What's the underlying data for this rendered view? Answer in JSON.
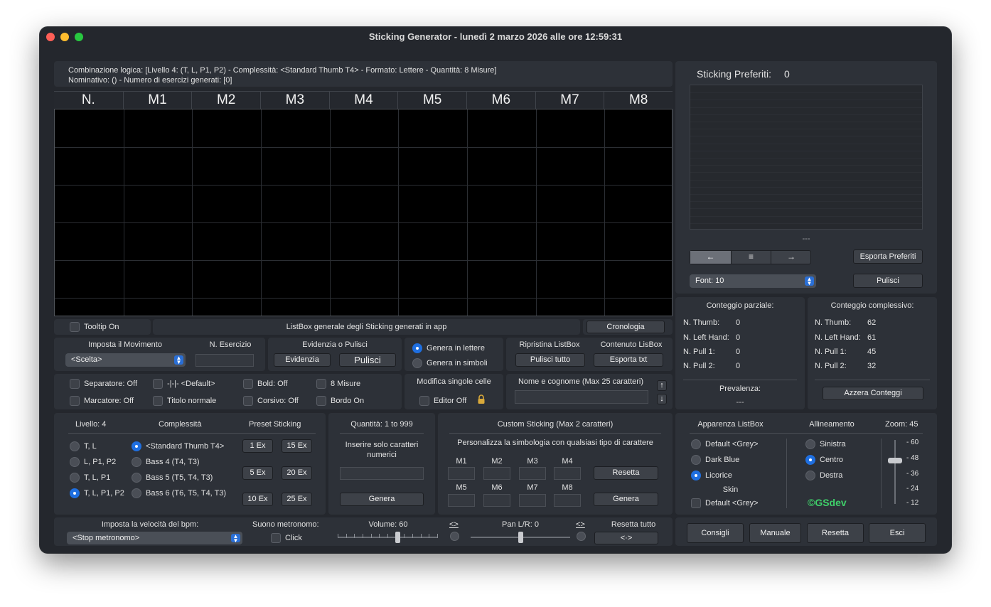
{
  "window": {
    "title": "Sticking Generator - lunedì 2 marzo 2026 alle ore 12:59:31",
    "traffic_colors": [
      "#ff5f57",
      "#febc2e",
      "#28c840"
    ]
  },
  "info": {
    "line1": "Combinazione logica: [Livello 4: (T, L, P1, P2) - Complessità: <Standard Thumb T4> - Formato: Lettere - Quantità: 8 Misure]",
    "line2": "Nominativo: () - Numero di esercizi generati: [0]"
  },
  "table": {
    "columns": [
      "N.",
      "M1",
      "M2",
      "M3",
      "M4",
      "M5",
      "M6",
      "M7",
      "M8"
    ]
  },
  "listbar": {
    "tooltip_label": "Tooltip On",
    "caption": "ListBox generale degli Sticking generati in app",
    "cronologia": "Cronologia"
  },
  "movimento": {
    "title": "Imposta il Movimento",
    "select": "<Scelta>",
    "esercizio_title": "N. Esercizio"
  },
  "evidenzia": {
    "title": "Evidenzia o Pulisci",
    "evidenzia": "Evidenzia",
    "pulisci": "Pulisci"
  },
  "genera_mode": {
    "lettere": "Genera in lettere",
    "simboli": "Genera in simboli"
  },
  "ripristina": {
    "title": "Ripristina ListBox",
    "button": "Pulisci tutto"
  },
  "contenuto": {
    "title": "Contenuto LisBox",
    "button": "Esporta txt"
  },
  "options": {
    "separatore": "Separatore: Off",
    "default_sep": "-|-|- <Default>",
    "bold": "Bold: Off",
    "misure": "8 Misure",
    "marcatore": "Marcatore: Off",
    "titolo": "Titolo normale",
    "corsivo": "Corsivo: Off",
    "bordo": "Bordo On"
  },
  "modifica": {
    "title": "Modifica singole celle",
    "editor": "Editor Off"
  },
  "nome": {
    "title": "Nome e cognome (Max 25 caratteri)"
  },
  "preferiti": {
    "title": "Sticking Preferiti:",
    "count": "0",
    "placeholder": "---",
    "nav_left": "←",
    "nav_menu": "≡",
    "nav_right": "→",
    "esporta": "Esporta Preferiti",
    "font": "Font: 10",
    "pulisci": "Pulisci"
  },
  "parziale": {
    "title": "Conteggio parziale:",
    "rows": [
      {
        "label": "N. Thumb:",
        "value": "0"
      },
      {
        "label": "N. Left Hand:",
        "value": "0"
      },
      {
        "label": "N. Pull 1:",
        "value": "0"
      },
      {
        "label": "N. Pull 2:",
        "value": "0"
      }
    ],
    "prevalenza_title": "Prevalenza:",
    "prevalenza_value": "---"
  },
  "complessivo": {
    "title": "Conteggio complessivo:",
    "rows": [
      {
        "label": "N. Thumb:",
        "value": "62"
      },
      {
        "label": "N. Left Hand:",
        "value": "61"
      },
      {
        "label": "N. Pull 1:",
        "value": "45"
      },
      {
        "label": "N. Pull 2:",
        "value": "32"
      }
    ],
    "azzera": "Azzera Conteggi"
  },
  "livello": {
    "title": "Livello: 4",
    "options": [
      "T, L",
      "L, P1, P2",
      "T, L, P1",
      "T, L, P1, P2"
    ],
    "selected_index": 3
  },
  "complessita": {
    "title": "Complessità",
    "options": [
      "<Standard Thumb T4>",
      "Bass 4 (T4, T3)",
      "Bass 5 (T5, T4, T3)",
      "Bass 6 (T6, T5, T4, T3)"
    ],
    "selected_index": 0
  },
  "preset": {
    "title": "Preset Sticking",
    "buttons": [
      "1 Ex",
      "15 Ex",
      "5 Ex",
      "20 Ex",
      "10 Ex",
      "25 Ex"
    ]
  },
  "quantita": {
    "title": "Quantità: 1 to 999",
    "hint": "Inserire solo caratteri numerici",
    "genera": "Genera"
  },
  "custom": {
    "title": "Custom Sticking (Max 2 caratteri)",
    "subtitle": "Personalizza la simbologia con qualsiasi tipo di carattere",
    "labels": [
      "M1",
      "M2",
      "M3",
      "M4",
      "M5",
      "M6",
      "M7",
      "M8"
    ],
    "resetta": "Resetta",
    "genera": "Genera"
  },
  "apparenza": {
    "title": "Apparenza ListBox",
    "options": [
      "Default <Grey>",
      "Dark Blue",
      "Licorice"
    ],
    "selected_index": 2,
    "skin_title": "Skin",
    "skin_option": "Default <Grey>"
  },
  "allineamento": {
    "title": "Allineamento",
    "options": [
      "Sinistra",
      "Centro",
      "Destra"
    ],
    "selected_index": 1,
    "brand": "©GSdev",
    "brand_color": "#3fd06a"
  },
  "zoom": {
    "title": "Zoom: 45",
    "ticks": [
      "- 60",
      "- 48",
      "- 36",
      "- 24",
      "- 12"
    ],
    "value": 45,
    "min": 12,
    "max": 60
  },
  "bpm": {
    "title": "Imposta la velocità del bpm:",
    "select": "<Stop metronomo>"
  },
  "suono": {
    "title": "Suono metronomo:",
    "click": "Click"
  },
  "volume": {
    "title": "Volume: 60",
    "value": 60,
    "reset": "<>"
  },
  "pan": {
    "title": "Pan L/R: 0",
    "value": 0,
    "reset": "<>"
  },
  "resetta_tutto": {
    "title": "Resetta tutto",
    "button": "<·>"
  },
  "footer": {
    "consigli": "Consigli",
    "manuale": "Manuale",
    "resetta": "Resetta",
    "esci": "Esci"
  }
}
